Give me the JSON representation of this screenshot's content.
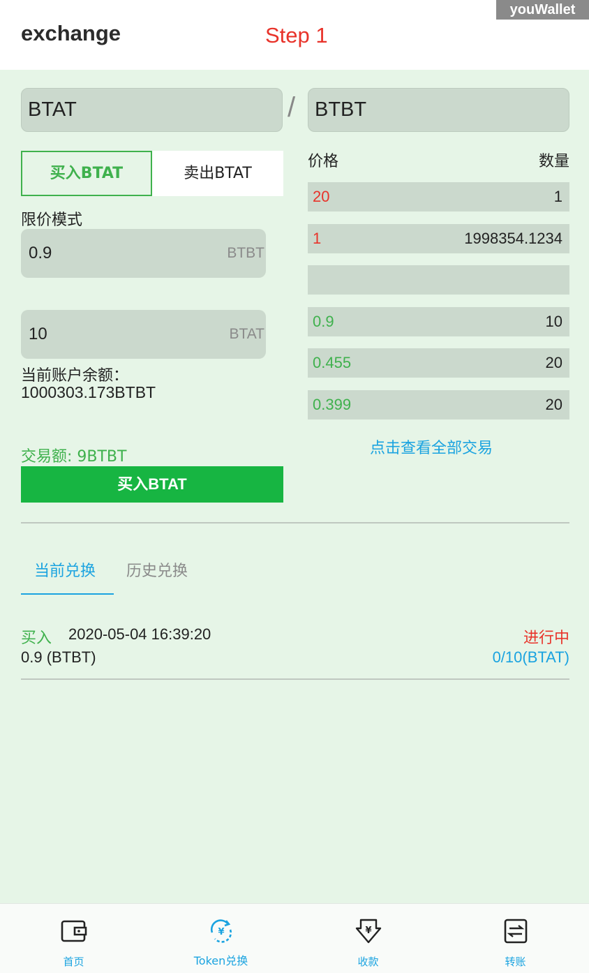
{
  "header": {
    "title": "exchange",
    "step": "Step 1",
    "watermark": "youWallet"
  },
  "pair": {
    "base": "BTAT",
    "separator": "/",
    "quote": "BTBT"
  },
  "trade": {
    "tabs": {
      "buy": "买入BTAT",
      "sell": "卖出BTAT"
    },
    "mode_label": "限价模式",
    "price": {
      "value": "0.9",
      "unit": "BTBT"
    },
    "amount": {
      "value": "10",
      "unit": "BTAT"
    },
    "balance_label": "当前账户余额：",
    "balance_value": "1000303.173BTBT",
    "trade_amount": "交易额: 9BTBT",
    "submit_label": "买入BTAT"
  },
  "orderbook": {
    "price_header": "价格",
    "qty_header": "数量",
    "sells": [
      {
        "price": "20",
        "qty": "1"
      },
      {
        "price": "1",
        "qty": "1998354.1234"
      }
    ],
    "buys": [
      {
        "price": "0.9",
        "qty": "10"
      },
      {
        "price": "0.455",
        "qty": "20"
      },
      {
        "price": "0.399",
        "qty": "20"
      }
    ],
    "view_all": "点击查看全部交易"
  },
  "orders": {
    "tabs": {
      "current": "当前兑换",
      "history": "历史兑换"
    },
    "items": [
      {
        "side": "买入",
        "time": "2020-05-04 16:39:20",
        "price": "0.9 (BTBT)",
        "status": "进行中",
        "progress": "0/10(BTAT)"
      }
    ]
  },
  "nav": {
    "items": [
      {
        "label": "首页",
        "icon": "wallet-icon"
      },
      {
        "label": "Token兑换",
        "icon": "exchange-icon"
      },
      {
        "label": "收款",
        "icon": "receive-icon"
      },
      {
        "label": "转账",
        "icon": "transfer-icon"
      }
    ]
  },
  "colors": {
    "background": "#e6f5e7",
    "buy_green": "#17b542",
    "sell_red": "#e8332a",
    "accent_blue": "#1aa3e0"
  }
}
